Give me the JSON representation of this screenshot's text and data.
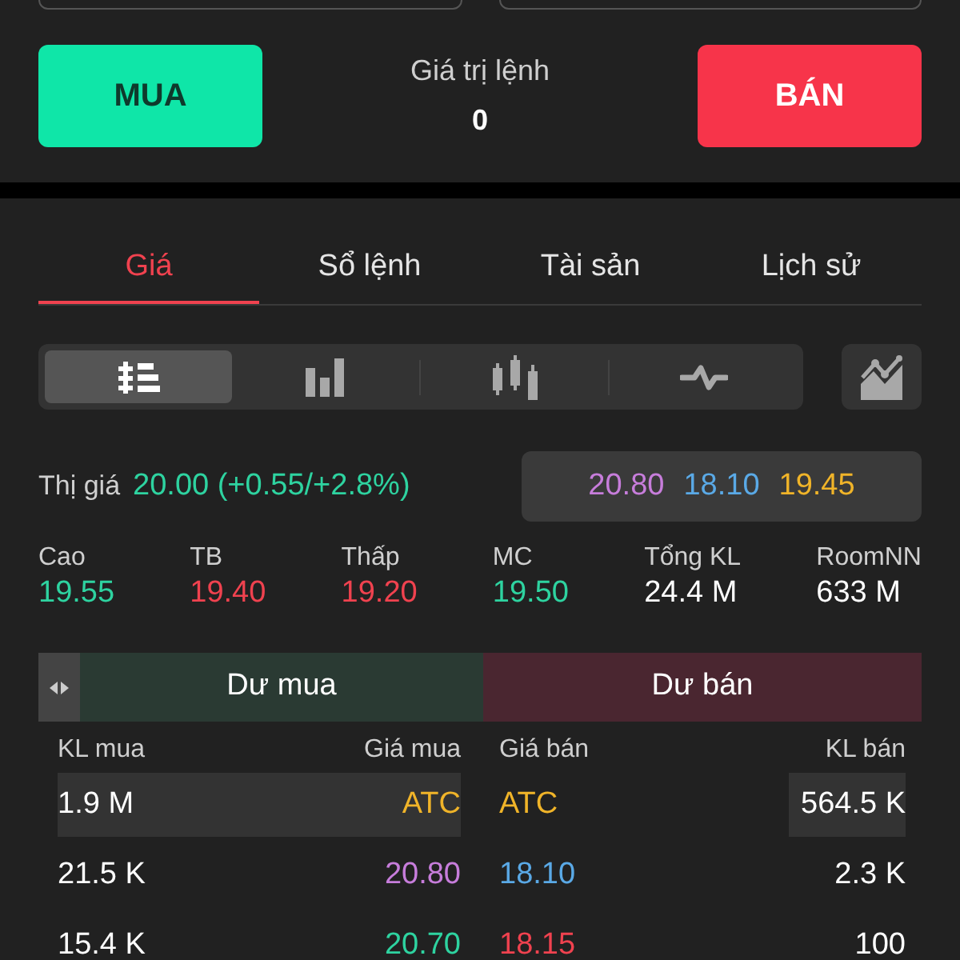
{
  "order_fields": [
    {
      "kind": "field"
    },
    {
      "kind": "field"
    }
  ],
  "actions": {
    "buy_label": "MUA",
    "value_label": "Giá trị lệnh",
    "value": "0",
    "sell_label": "BÁN"
  },
  "tabs": [
    {
      "label": "Giá",
      "selected": true
    },
    {
      "label": "Sổ lệnh",
      "selected": false
    },
    {
      "label": "Tài sản",
      "selected": false
    },
    {
      "label": "Lịch sử",
      "selected": false
    }
  ],
  "view_modes": [
    {
      "kind": "orderbook",
      "selected": true
    },
    {
      "kind": "bars",
      "selected": false
    },
    {
      "kind": "candles",
      "selected": false
    },
    {
      "kind": "wave",
      "selected": false
    }
  ],
  "market_price": {
    "label": "Thị giá",
    "value": "20.00 (+0.55/+2.8%)",
    "color": "#2ed3a0"
  },
  "reference_prices": [
    {
      "value": "20.80",
      "color": "#c77ddb"
    },
    {
      "value": "18.10",
      "color": "#5aa9e6"
    },
    {
      "value": "19.45",
      "color": "#f0b429"
    }
  ],
  "stats": [
    {
      "label": "Cao",
      "value": "19.55",
      "color": "#2ed3a0"
    },
    {
      "label": "TB",
      "value": "19.40",
      "color": "#f0424f"
    },
    {
      "label": "Thấp",
      "value": "19.20",
      "color": "#f0424f"
    },
    {
      "label": "MC",
      "value": "19.50",
      "color": "#2ed3a0"
    },
    {
      "label": "Tổng KL",
      "value": "24.4 M",
      "color": "#ffffff"
    },
    {
      "label": "RoomNN",
      "value": "633 M",
      "color": "#ffffff"
    }
  ],
  "depth_header": {
    "buy": "Dư mua",
    "sell": "Dư bán"
  },
  "order_book": {
    "columns": [
      "KL mua",
      "Giá mua",
      "Giá bán",
      "KL bán"
    ],
    "rows": [
      {
        "buy": {
          "volume": "1.9 M",
          "price": "ATC",
          "color": "#f0b429",
          "highlighted": true
        },
        "sell": {
          "volume": "564.5 K",
          "price": "ATC",
          "color": "#f0b429",
          "highlighted": true
        }
      },
      {
        "buy": {
          "volume": "21.5 K",
          "price": "20.80",
          "color": "#c77ddb",
          "highlighted": false
        },
        "sell": {
          "volume": "2.3 K",
          "price": "18.10",
          "color": "#5aa9e6",
          "highlighted": false
        }
      },
      {
        "buy": {
          "volume": "15.4 K",
          "price": "20.70",
          "color": "#2ed3a0",
          "highlighted": false
        },
        "sell": {
          "volume": "100",
          "price": "18.15",
          "color": "#f0424f",
          "highlighted": false
        }
      }
    ]
  }
}
